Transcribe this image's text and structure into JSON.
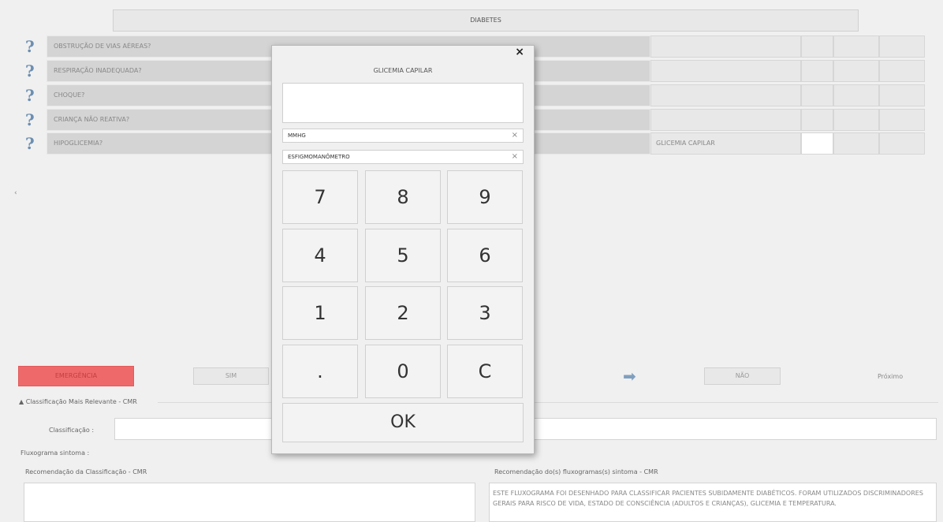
{
  "header": {
    "title": "DIABETES"
  },
  "questions": [
    {
      "label": "OBSTRUÇÃO DE VIAS AÉREAS?",
      "result": ""
    },
    {
      "label": "RESPIRAÇÃO INADEQUADA?",
      "result": ""
    },
    {
      "label": "CHOQUE?",
      "result": ""
    },
    {
      "label": "CRIANÇA NÃO REATIVA?",
      "result": ""
    },
    {
      "label": "HIPOGLICEMIA?",
      "result": "GLICEMIA CAPILAR"
    }
  ],
  "question_icon": "?",
  "nav": {
    "left_arrow": "‹"
  },
  "actions": {
    "emergency": "EMERGÊNCIA",
    "yes": "SIM",
    "no": "NÃO",
    "next": "Próximo",
    "arrow_icon": "➡"
  },
  "classification": {
    "section_title": "Classificação Mais Relevante - CMR",
    "collapse_icon": "▲",
    "class_label": "Classificação :",
    "flux_label": "Fluxograma sintoma :",
    "rec_class_label": "Recomendação da Classificação - CMR",
    "rec_flux_label": "Recomendação do(s) fluxogramas(s) sintoma - CMR",
    "rec_flux_text": "ESTE FLUXOGRAMA FOI DESENHADO PARA CLASSIFICAR PACIENTES SUBIDAMENTE DIABÉTICOS. FORAM UTILIZADOS DISCRIMINADORES GERAIS PARA RISCO DE VIDA, ESTADO DE CONSCIÊNCIA (ADULTOS E CRIANÇAS), GLICEMIA E TEMPERATURA."
  },
  "modal": {
    "title": "GLICEMIA CAPILAR",
    "close": "×",
    "value": "",
    "unit": "MMHG",
    "device": "ESFIGMOMANÔMETRO",
    "clear_x": "×",
    "keys": [
      "7",
      "8",
      "9",
      "4",
      "5",
      "6",
      "1",
      "2",
      "3",
      ".",
      "0",
      "C"
    ],
    "ok": "OK"
  },
  "colors": {
    "emergency": "#ee6a6a",
    "question_icon": "#6c8eb1"
  }
}
